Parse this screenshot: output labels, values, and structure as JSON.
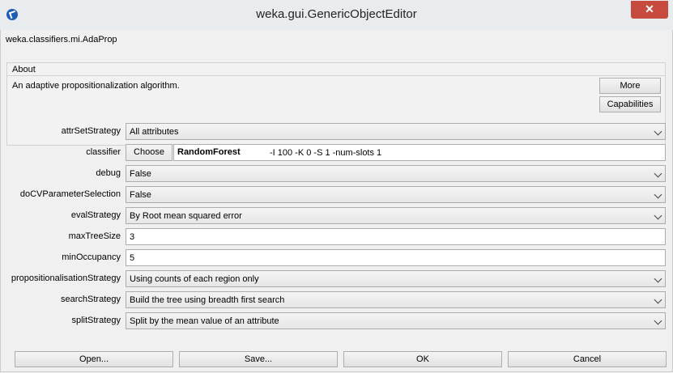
{
  "window": {
    "title": "weka.gui.GenericObjectEditor",
    "close_glyph": "✕"
  },
  "object": {
    "class_name": "weka.classifiers.mi.AdaProp"
  },
  "about": {
    "title": "About",
    "description": "An adaptive propositionalization algorithm.",
    "more_label": "More",
    "capabilities_label": "Capabilities"
  },
  "properties": {
    "attrSetStrategy": {
      "label": "attrSetStrategy",
      "value": "All attributes"
    },
    "classifier": {
      "label": "classifier",
      "choose_label": "Choose",
      "name": "RandomForest",
      "options": "-I 100 -K 0 -S 1 -num-slots 1"
    },
    "debug": {
      "label": "debug",
      "value": "False"
    },
    "doCVParameterSelection": {
      "label": "doCVParameterSelection",
      "value": "False"
    },
    "evalStrategy": {
      "label": "evalStrategy",
      "value": "By Root mean squared error"
    },
    "maxTreeSize": {
      "label": "maxTreeSize",
      "value": "3"
    },
    "minOccupancy": {
      "label": "minOccupancy",
      "value": "5"
    },
    "propositionalisationStrategy": {
      "label": "propositionalisationStrategy",
      "value": "Using counts of each region only"
    },
    "searchStrategy": {
      "label": "searchStrategy",
      "value": "Build the tree using breadth first search"
    },
    "splitStrategy": {
      "label": "splitStrategy",
      "value": "Split by the mean value of an attribute"
    }
  },
  "buttons": {
    "open": "Open...",
    "save": "Save...",
    "ok": "OK",
    "cancel": "Cancel"
  },
  "colors": {
    "close_button": "#c74a3f",
    "window_bg": "#f0f0f0"
  }
}
